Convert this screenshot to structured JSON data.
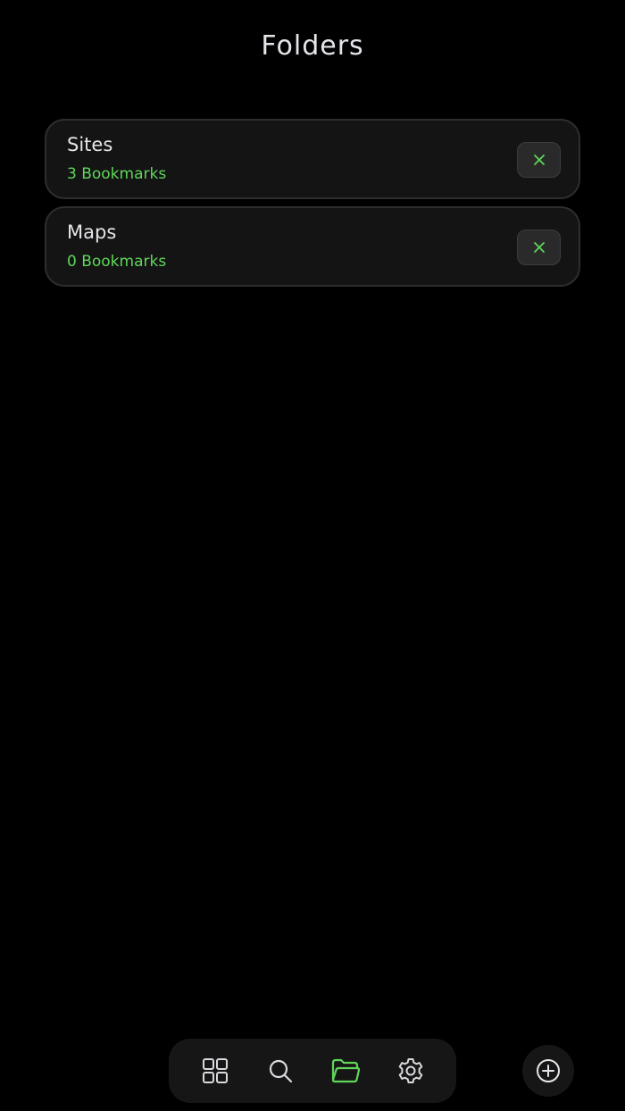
{
  "header": {
    "title": "Folders"
  },
  "folders": [
    {
      "name": "Sites",
      "count_label": "3 Bookmarks",
      "delete_icon": "close-icon"
    },
    {
      "name": "Maps",
      "count_label": "0 Bookmarks",
      "delete_icon": "close-icon"
    }
  ],
  "bottom_nav": {
    "items": [
      {
        "icon": "grid-icon",
        "active": false
      },
      {
        "icon": "search-icon",
        "active": false
      },
      {
        "icon": "folder-icon",
        "active": true
      },
      {
        "icon": "gear-icon",
        "active": false
      }
    ]
  },
  "fab": {
    "icon": "add-icon"
  },
  "colors": {
    "background": "#000000",
    "card": "#141414",
    "accent": "#5fd65a",
    "icon": "#d9d9de"
  }
}
